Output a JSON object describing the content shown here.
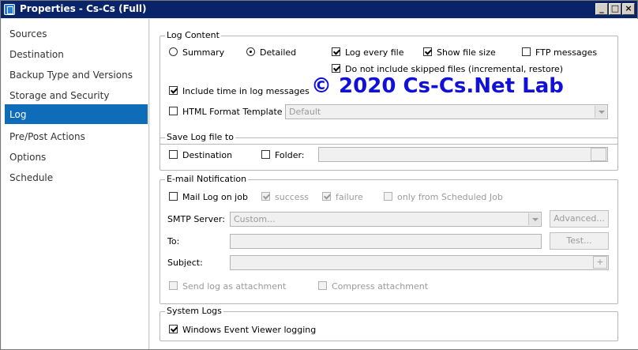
{
  "window": {
    "title": "Properties - Cs-Cs (Full)",
    "minimize_label": "_",
    "maximize_label": "□",
    "close_label": "×"
  },
  "sidebar": {
    "items": [
      {
        "label": "Sources"
      },
      {
        "label": "Destination"
      },
      {
        "label": "Backup Type and Versions"
      },
      {
        "label": "Storage and Security"
      },
      {
        "label": "Log",
        "active": true
      },
      {
        "label": "Pre/Post Actions"
      },
      {
        "label": "Options"
      },
      {
        "label": "Schedule"
      }
    ]
  },
  "log_content": {
    "legend": "Log Content",
    "summary_label": "Summary",
    "summary_checked": false,
    "detailed_label": "Detailed",
    "detailed_checked": true,
    "log_every_file_label": "Log every file",
    "log_every_file_checked": true,
    "show_file_size_label": "Show file size",
    "show_file_size_checked": true,
    "ftp_messages_label": "FTP messages",
    "ftp_messages_checked": false,
    "skip_label": "Do not include skipped files (incremental, restore)",
    "skip_checked": true,
    "include_time_label": "Include time in log messages",
    "include_time_checked": true,
    "html_template_label": "HTML Format Template",
    "html_template_checked": false,
    "template_value": "Default"
  },
  "save_log": {
    "legend": "Save Log file to",
    "destination_label": "Destination",
    "folder_label": "Folder:",
    "folder_value": ""
  },
  "email": {
    "legend": "E-mail Notification",
    "mail_log_label": "Mail Log on job",
    "success_label": "success",
    "failure_label": "failure",
    "scheduled_label": "only from Scheduled Job",
    "smtp_label": "SMTP Server:",
    "smtp_value": "Custom...",
    "advanced_label": "Advanced...",
    "to_label": "To:",
    "test_label": "Test...",
    "subject_label": "Subject:",
    "plus_label": "+",
    "attach_label": "Send log as attachment",
    "compress_label": "Compress attachment"
  },
  "system_logs": {
    "legend": "System Logs",
    "event_viewer_label": "Windows Event Viewer logging",
    "event_viewer_checked": true
  },
  "watermark": "© 2020 Cs-Cs.Net Lab"
}
